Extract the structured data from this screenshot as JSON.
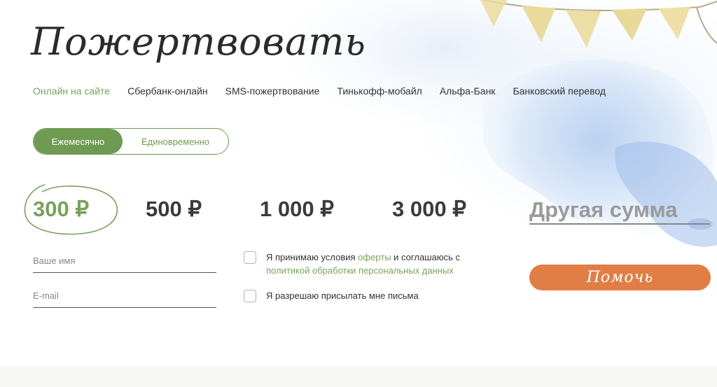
{
  "page": {
    "title": "Пожертвовать"
  },
  "tabs": [
    {
      "label": "Онлайн на сайте",
      "active": true
    },
    {
      "label": "Сбербанк-онлайн"
    },
    {
      "label": "SMS-пожертвование"
    },
    {
      "label": "Тинькофф-мобайл"
    },
    {
      "label": "Альфа-Банк"
    },
    {
      "label": "Банковский перевод"
    }
  ],
  "frequency": {
    "monthly": "Ежемесячно",
    "once": "Единовременно",
    "selected": "monthly"
  },
  "amounts": [
    {
      "label": "300 ₽",
      "selected": true
    },
    {
      "label": "500 ₽"
    },
    {
      "label": "1 000 ₽"
    },
    {
      "label": "3 000 ₽"
    }
  ],
  "other_amount": {
    "placeholder": "Другая сумма"
  },
  "form": {
    "name_placeholder": "Ваше имя",
    "email_placeholder": "E-mail"
  },
  "consent": {
    "text1": "Я принимаю условия ",
    "link1": "оферты",
    "text2": " и соглашаюсь с",
    "link2": "политикой обработки персональных данных",
    "newsletter": "Я разрешаю присылать мне письма"
  },
  "submit": {
    "label": "Помочь"
  },
  "colors": {
    "accent_green": "#78a25a",
    "toggle_green": "#6f9a52",
    "button_orange": "#e07e45",
    "flag_yellow": "#eadb9e",
    "watercolor_blue": "#b9d2f1"
  },
  "decor": {
    "bunting": "bunting-flags-icon",
    "watercolor": "watercolor-splash"
  }
}
